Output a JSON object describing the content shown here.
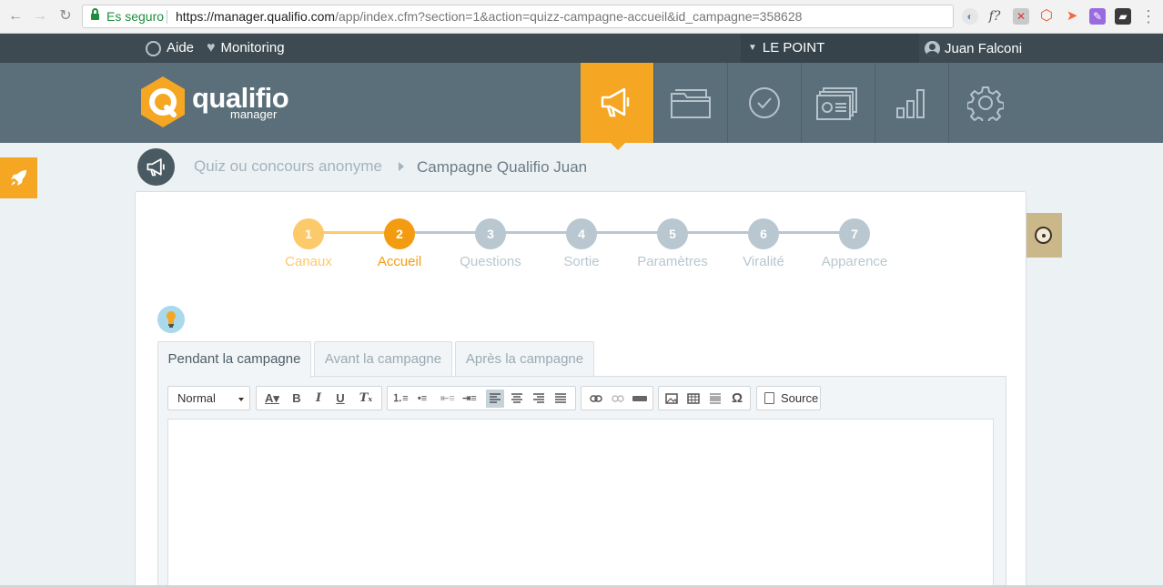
{
  "browser": {
    "secure_label": "Es seguro",
    "url_host": "https://manager.qualifio.com",
    "url_path": "/app/index.cfm?section=1&action=quizz-campagne-accueil&id_campagne=358628",
    "ext_f_label": "f?"
  },
  "topbar": {
    "help_label": "Aide",
    "monitoring_label": "Monitoring",
    "account_label": "LE POINT",
    "user_label": "Juan Falconi"
  },
  "logo": {
    "name": "qualifio",
    "sub": "manager",
    "brand_color": "#f5a623"
  },
  "main_nav": [
    {
      "icon": "megaphone-icon",
      "active": true
    },
    {
      "icon": "folder-icon",
      "active": false
    },
    {
      "icon": "check-circle-icon",
      "active": false
    },
    {
      "icon": "contacts-icon",
      "active": false
    },
    {
      "icon": "bar-chart-icon",
      "active": false
    },
    {
      "icon": "gear-icon",
      "active": false
    }
  ],
  "breadcrumb": {
    "parent": "Quiz ou concours anonyme",
    "current": "Campagne Qualifio Juan"
  },
  "stepper": {
    "steps": [
      {
        "number": "1",
        "label": "Canaux",
        "state": "done"
      },
      {
        "number": "2",
        "label": "Accueil",
        "state": "current"
      },
      {
        "number": "3",
        "label": "Questions",
        "state": "todo"
      },
      {
        "number": "4",
        "label": "Sortie",
        "state": "todo"
      },
      {
        "number": "5",
        "label": "Paramètres",
        "state": "todo"
      },
      {
        "number": "6",
        "label": "Viralité",
        "state": "todo"
      },
      {
        "number": "7",
        "label": "Apparence",
        "state": "todo"
      }
    ],
    "colors": {
      "done": "#fcc96b",
      "current": "#f39c12",
      "todo": "#b8c7d0"
    }
  },
  "tabs": [
    {
      "label": "Pendant la campagne",
      "active": true
    },
    {
      "label": "Avant la campagne",
      "active": false
    },
    {
      "label": "Après la campagne",
      "active": false
    }
  ],
  "editor": {
    "format_value": "Normal",
    "source_label": "Source",
    "content": ""
  }
}
